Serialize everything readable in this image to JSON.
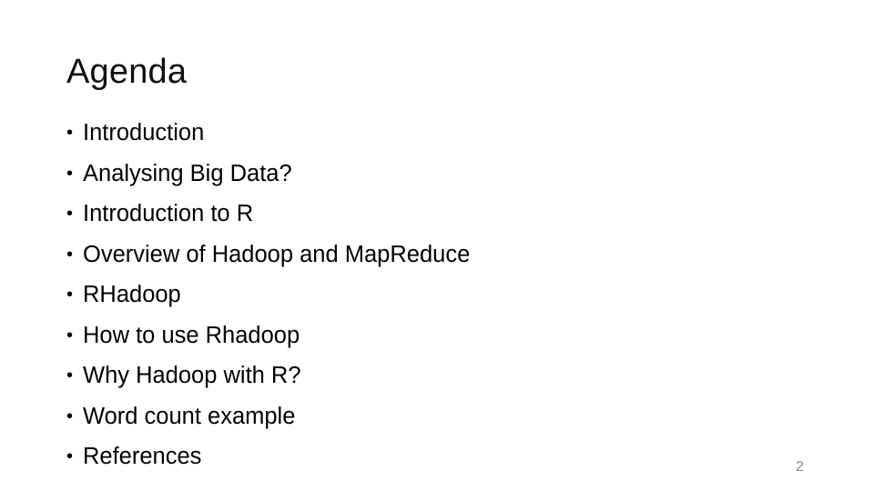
{
  "slide": {
    "title": "Agenda",
    "bullet_glyph": "•",
    "items": [
      "Introduction",
      "Analysing Big Data?",
      "Introduction to R",
      "Overview of Hadoop and MapReduce",
      "RHadoop",
      "How to use Rhadoop",
      "Why Hadoop with R?",
      "Word count example",
      "References"
    ],
    "page_number": "2"
  }
}
